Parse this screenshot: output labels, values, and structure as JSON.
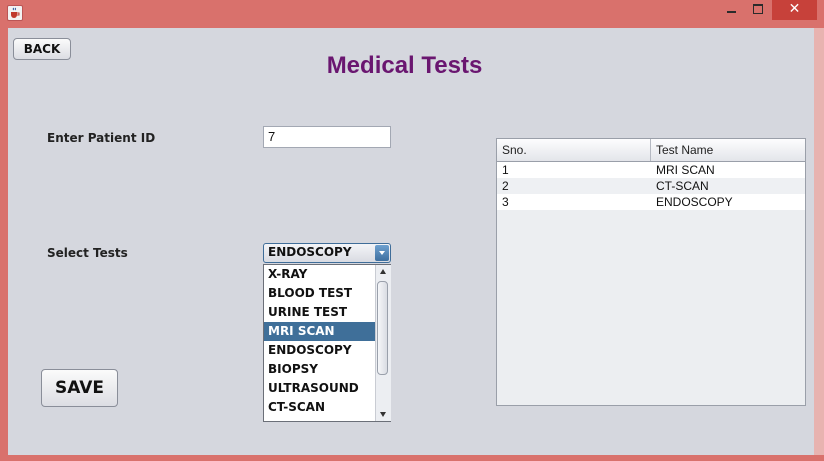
{
  "window": {
    "icon": "java-cup-icon",
    "close_symbol": "✕"
  },
  "back_button": "BACK",
  "page_title": "Medical Tests",
  "patient": {
    "label": "Enter Patient ID",
    "value": "7"
  },
  "tests": {
    "label": "Select Tests",
    "selected": "ENDOSCOPY",
    "options": [
      "X-RAY",
      "BLOOD TEST",
      "URINE TEST",
      "MRI SCAN",
      "ENDOSCOPY",
      "BIOPSY",
      "ULTRASOUND",
      "CT-SCAN"
    ],
    "highlighted": "MRI SCAN"
  },
  "save_button": "SAVE",
  "table": {
    "columns": [
      "Sno.",
      "Test Name"
    ],
    "rows": [
      {
        "sno": "1",
        "name": "MRI SCAN"
      },
      {
        "sno": "2",
        "name": "CT-SCAN"
      },
      {
        "sno": "3",
        "name": "ENDOSCOPY"
      }
    ]
  },
  "colors": {
    "title": "#6a1670",
    "selection": "#3f6f99",
    "frame": "#d9716c",
    "close": "#c7413a"
  }
}
